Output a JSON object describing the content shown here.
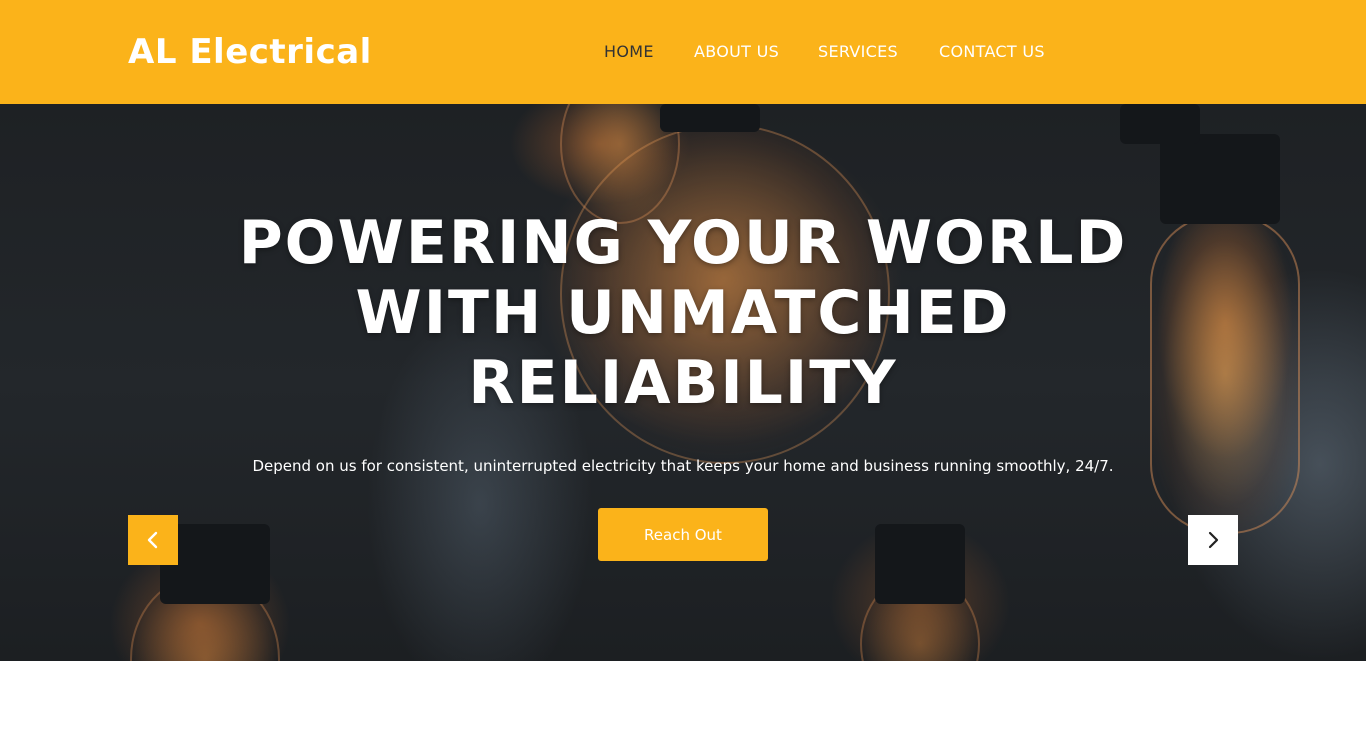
{
  "brand": {
    "name": "AL Electrical"
  },
  "nav": {
    "items": [
      {
        "label": "HOME",
        "active": true
      },
      {
        "label": "ABOUT US",
        "active": false
      },
      {
        "label": "SERVICES",
        "active": false
      },
      {
        "label": "CONTACT US",
        "active": false
      }
    ]
  },
  "hero": {
    "title_lines": [
      "POWERING YOUR WORLD",
      "WITH UNMATCHED",
      "RELIABILITY"
    ],
    "subtitle": "Depend on us for consistent, uninterrupted electricity that keeps your home and business running smoothly, 24/7.",
    "cta_label": "Reach Out",
    "prev_icon": "chevron-left-icon",
    "next_icon": "chevron-right-icon"
  },
  "colors": {
    "accent": "#fbb31a",
    "nav_active": "#333333",
    "text_light": "#ffffff"
  }
}
